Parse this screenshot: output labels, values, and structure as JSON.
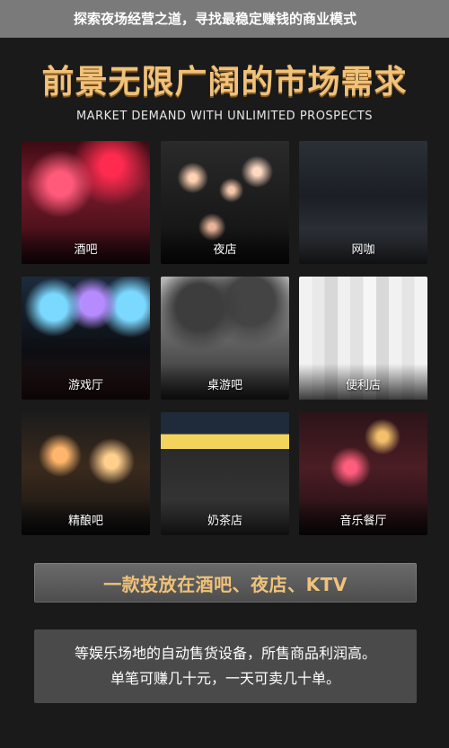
{
  "banner": {
    "title": "探索夜场经营之道，寻找最稳定赚钱的商业模式"
  },
  "hero": {
    "title": "前景无限广阔的市场需求",
    "subtitle": "MARKET DEMAND WITH UNLIMITED PROSPECTS"
  },
  "tiles": [
    {
      "label": "酒吧"
    },
    {
      "label": "夜店"
    },
    {
      "label": "网咖"
    },
    {
      "label": "游戏厅"
    },
    {
      "label": "桌游吧"
    },
    {
      "label": "便利店"
    },
    {
      "label": "精酿吧"
    },
    {
      "label": "奶茶店"
    },
    {
      "label": "音乐餐厅"
    }
  ],
  "cta": {
    "text": "一款投放在酒吧、夜店、KTV"
  },
  "info": {
    "line1": "等娱乐场地的自动售货设备，所售商品利润高。",
    "line2": "单笔可赚几十元，一天可卖几十单。"
  }
}
